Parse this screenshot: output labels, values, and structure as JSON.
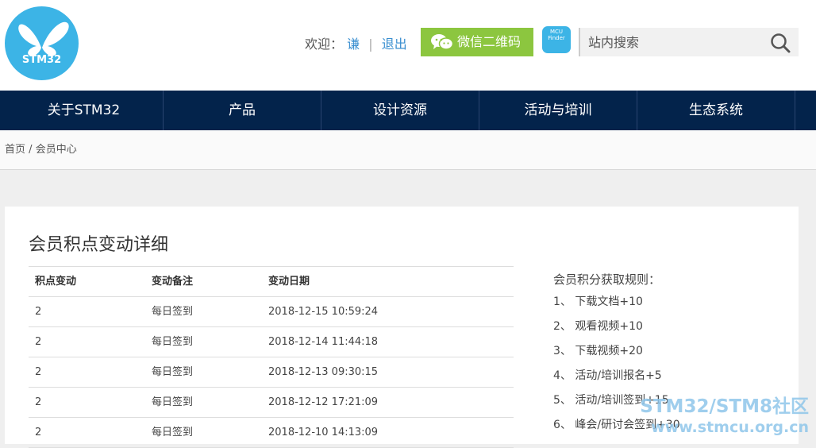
{
  "header": {
    "logo_text": "STM32",
    "welcome_label": "欢迎：",
    "username": "谦",
    "separator": "|",
    "logout": "退出",
    "wechat_button": "微信二维码",
    "mcu_finder": {
      "line1": "MCU",
      "line2": "Finder"
    },
    "search_placeholder": "站内搜索"
  },
  "nav": {
    "items": [
      {
        "label": "关于STM32"
      },
      {
        "label": "产品"
      },
      {
        "label": "设计资源"
      },
      {
        "label": "活动与培训"
      },
      {
        "label": "生态系统"
      }
    ]
  },
  "breadcrumb": {
    "home": "首页",
    "separator": "/",
    "current": "会员中心"
  },
  "panel": {
    "title": "会员积点变动详细",
    "columns": [
      "积点变动",
      "变动备注",
      "变动日期"
    ],
    "rows": [
      {
        "points": "2",
        "note": "每日签到",
        "date": "2018-12-15 10:59:24"
      },
      {
        "points": "2",
        "note": "每日签到",
        "date": "2018-12-14 11:44:18"
      },
      {
        "points": "2",
        "note": "每日签到",
        "date": "2018-12-13 09:30:15"
      },
      {
        "points": "2",
        "note": "每日签到",
        "date": "2018-12-12 17:21:09"
      },
      {
        "points": "2",
        "note": "每日签到",
        "date": "2018-12-10 14:13:09"
      }
    ]
  },
  "rules": {
    "title": "会员积分获取规则：",
    "items": [
      "1、 下载文档+10",
      "2、 观看视频+10",
      "3、 下载视频+20",
      "4、 活动/培训报名+5",
      "5、 活动/培训签到+15",
      "6、 峰会/研讨会签到+30"
    ]
  },
  "watermark": {
    "line1": "STM32/STM8社区",
    "line2": "www.stmcu.org.cn"
  },
  "colors": {
    "nav_bg": "#03234b",
    "logo_bg": "#3cb4e6",
    "wechat_bg": "#8cc63f",
    "link": "#3a8fd0"
  }
}
